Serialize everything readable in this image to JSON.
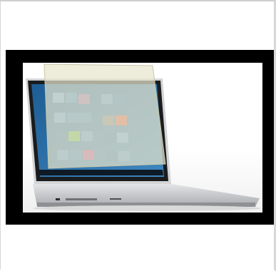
{
  "image": {
    "subject": "laptop-with-privacy-filter",
    "colors": {
      "frame_border": "#d6d6d6",
      "photo_background": "#000000",
      "laptop_body": "#c9cacd",
      "screen_blue": "#2f6fa3"
    }
  }
}
